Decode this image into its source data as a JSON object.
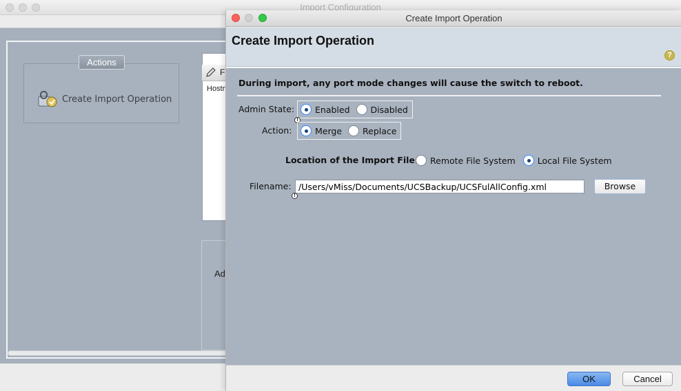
{
  "background_window": {
    "title": "Import Configuration",
    "actions_tab": "Actions",
    "action_item": "Create Import Operation",
    "panel_header_fragment": "Fi",
    "panel_row_fragment": "Hostn",
    "lower_panel_fragment": "Ad"
  },
  "dialog": {
    "window_title": "Create Import Operation",
    "header_title": "Create Import Operation",
    "help_icon": "?",
    "warning": "During import, any port mode changes will cause the switch to reboot.",
    "admin_state": {
      "label": "Admin State:",
      "options": [
        "Enabled",
        "Disabled"
      ],
      "selected": "Enabled"
    },
    "action": {
      "label": "Action:",
      "options": [
        "Merge",
        "Replace"
      ],
      "selected": "Merge"
    },
    "location": {
      "label": "Location of the Import File:",
      "options": [
        "Remote File System",
        "Local File System"
      ],
      "selected": "Local File System"
    },
    "filename": {
      "label": "Filename:",
      "value": "/Users/vMiss/Documents/UCSBackup/UCSFulAllConfig.xml",
      "browse_label": "Browse"
    },
    "footer": {
      "ok_label": "OK",
      "cancel_label": "Cancel"
    }
  },
  "colors": {
    "dialog_body": "#a9b3bf",
    "header_band": "#d4dde5",
    "ok_button": "#4a8ae6",
    "close_button": "#fc605c",
    "maximize_button": "#34c84a",
    "help_icon": "#c7b84a"
  }
}
